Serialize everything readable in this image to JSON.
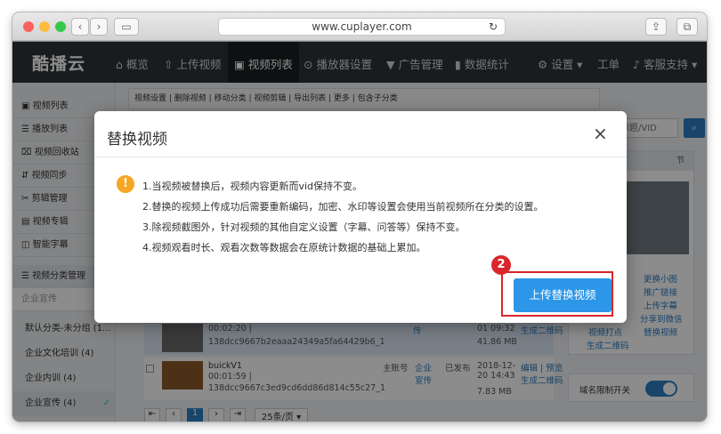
{
  "browser": {
    "url": "www.cuplayer.com"
  },
  "nav": {
    "logo": "酷播云",
    "items": [
      "概览",
      "上传视频",
      "视频列表",
      "播放器设置",
      "广告管理",
      "数据统计"
    ],
    "settings": "设置",
    "orders": "工单",
    "support": "客服支持"
  },
  "sidebar": {
    "items": [
      "视频列表",
      "播放列表",
      "视频回收站",
      "视频同步",
      "剪辑管理",
      "视频专辑",
      "智能字幕"
    ],
    "category_mgmt": "视频分类管理",
    "category_current": "企业宣传",
    "categories": [
      "默认分类-未分组 (1...",
      "企业文化培训 (4)",
      "企业内训 (4)",
      "企业宣传 (4)"
    ]
  },
  "toolbar": {
    "items": [
      "视频设置",
      "删除视频",
      "移动分类",
      "视频剪辑",
      "导出列表",
      "更多",
      "包含子分类"
    ],
    "search_placeholder": "频标题/VID"
  },
  "table": {
    "rows": [
      {
        "name": "",
        "duration": "00:02:20 |",
        "id": "138dcc9667b2eaaa24349a5fa64429b6_1",
        "owner": "",
        "category": "传",
        "status": "",
        "date": "01 09:32",
        "size": "41.86 MB",
        "ops": "生成二维码"
      },
      {
        "name": "buickV1",
        "duration": "00:01:59 |",
        "id": "138dcc9667c3ed9cd6dd86d814c55c27_1",
        "owner": "主账号",
        "category": "企业宣传",
        "status": "已发布",
        "date": "2018-12-20 14:43",
        "size": "7.83 MB",
        "ops": "编辑 | 预览 生成二维码"
      }
    ]
  },
  "pagination": {
    "current": "1",
    "per_page": "25条/页"
  },
  "right_panel": {
    "header": "节",
    "links": [
      "更换小图",
      "推广链接",
      "上传字幕",
      "分享到微信",
      "视频打点",
      "替换视频",
      "生成二维码"
    ],
    "domain_toggle": "域名限制开关"
  },
  "modal": {
    "title": "替换视频",
    "lines": [
      "1.当视频被替换后，视频内容更新而vid保持不变。",
      "2.替换的视频上传成功后需要重新编码，加密、水印等设置会使用当前视频所在分类的设置。",
      "3.除视频截图外，针对视频的其他自定义设置（字幕、问答等）保持不变。",
      "4.视频观看时长、观看次数等数据会在原统计数据的基础上累加。"
    ],
    "upload_button": "上传替换视频",
    "step_badge": "2"
  }
}
